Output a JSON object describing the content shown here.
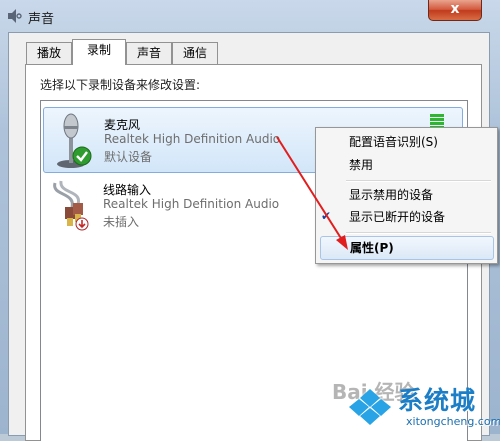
{
  "window": {
    "title": "声音",
    "close_label": "x"
  },
  "tabs": [
    {
      "label": "播放",
      "active": false
    },
    {
      "label": "录制",
      "active": true
    },
    {
      "label": "声音",
      "active": false
    },
    {
      "label": "通信",
      "active": false
    }
  ],
  "instruction": "选择以下录制设备来修改设置:",
  "devices": [
    {
      "name": "麦克风",
      "driver": "Realtek High Definition Audio",
      "status": "默认设备",
      "icon": "microphone-icon",
      "badge": "default-check-icon",
      "selected": true
    },
    {
      "name": "线路输入",
      "driver": "Realtek High Definition Audio",
      "status": "未插入",
      "icon": "line-in-jack-icon",
      "badge": "unplugged-icon",
      "selected": false
    }
  ],
  "context_menu": {
    "items": [
      {
        "label": "配置语音识别(S)"
      },
      {
        "label": "禁用"
      },
      {
        "label": "显示禁用的设备"
      },
      {
        "label": "显示已断开的设备",
        "checked": true
      },
      {
        "label": "属性(P)",
        "highlighted": true,
        "default": true
      }
    ]
  },
  "watermark": {
    "baidu": "Bai 经验",
    "brand": "系统城",
    "domain": "xitongcheng.com"
  },
  "colors": {
    "accent_arrow": "#e11d1d",
    "selection": "#d2e6f9",
    "brand": "#1b7ec6",
    "level_meter": "#2fb52f"
  }
}
